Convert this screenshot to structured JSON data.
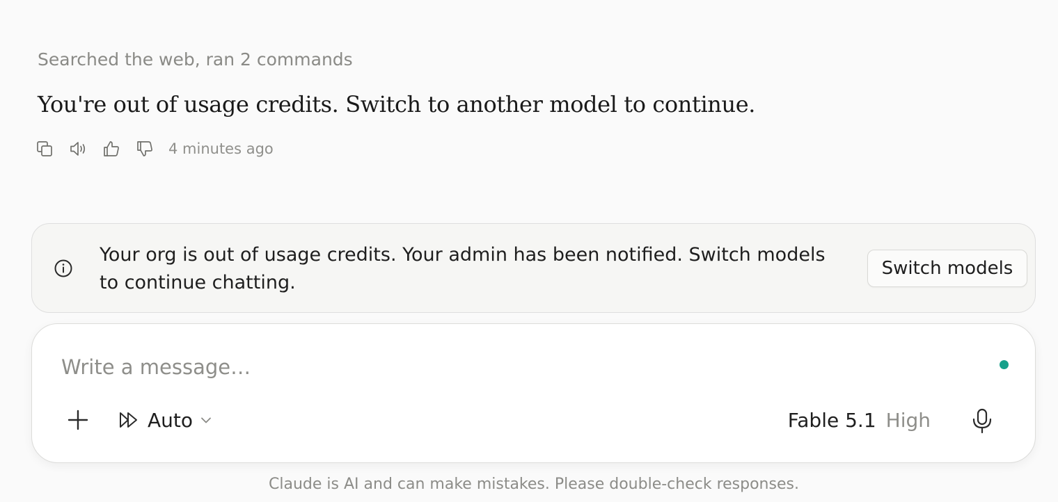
{
  "activity_summary": "Searched the web, ran 2 commands",
  "assistant_message": "You're out of usage credits. Switch to another model to continue.",
  "message_actions": {
    "icons": [
      "copy-icon",
      "speaker-icon",
      "thumbs-up-icon",
      "thumbs-down-icon"
    ],
    "timestamp": "4 minutes ago"
  },
  "notice": {
    "icon": "info-icon",
    "text": "Your org is out of usage credits. Your admin has been notified. Switch models to continue chatting.",
    "button_label": "Switch models"
  },
  "composer": {
    "placeholder": "Write a message…",
    "value": "",
    "status_dot_color": "#16a08a",
    "mode_label": "Auto",
    "model_name": "Fable 5.1",
    "effort_label": "High"
  },
  "disclaimer": "Claude is AI and can make mistakes. Please double-check responses."
}
